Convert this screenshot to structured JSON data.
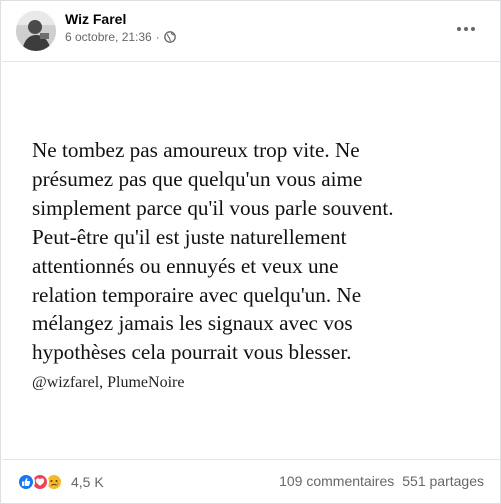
{
  "post": {
    "author": "Wiz Farel",
    "date": "6 octobre, 21:36",
    "separator": "·",
    "privacy_icon": "globe-icon",
    "menu_icon": "more-options-icon"
  },
  "image": {
    "quote_lines": [
      "Ne tombez pas amoureux trop vite. Ne",
      "présumez pas que quelqu'un vous aime",
      "simplement parce qu'il vous parle souvent.",
      "Peut-être qu'il est juste naturellement",
      "attentionnés ou ennuyés et veux une",
      "relation temporaire avec quelqu'un. Ne",
      "mélangez jamais les signaux avec vos",
      "hypothèses cela pourrait vous blesser."
    ],
    "signature": "@wizfarel, PlumeNoire"
  },
  "footer": {
    "reaction_icons": [
      "like-icon",
      "love-icon",
      "sad-icon"
    ],
    "reaction_count": "4,5 K",
    "comments": "109 commentaires",
    "shares": "551 partages"
  },
  "colors": {
    "like": "#1877f2",
    "love": "#f33e58",
    "sad": "#f7b928",
    "secondary_text": "#65676b"
  }
}
